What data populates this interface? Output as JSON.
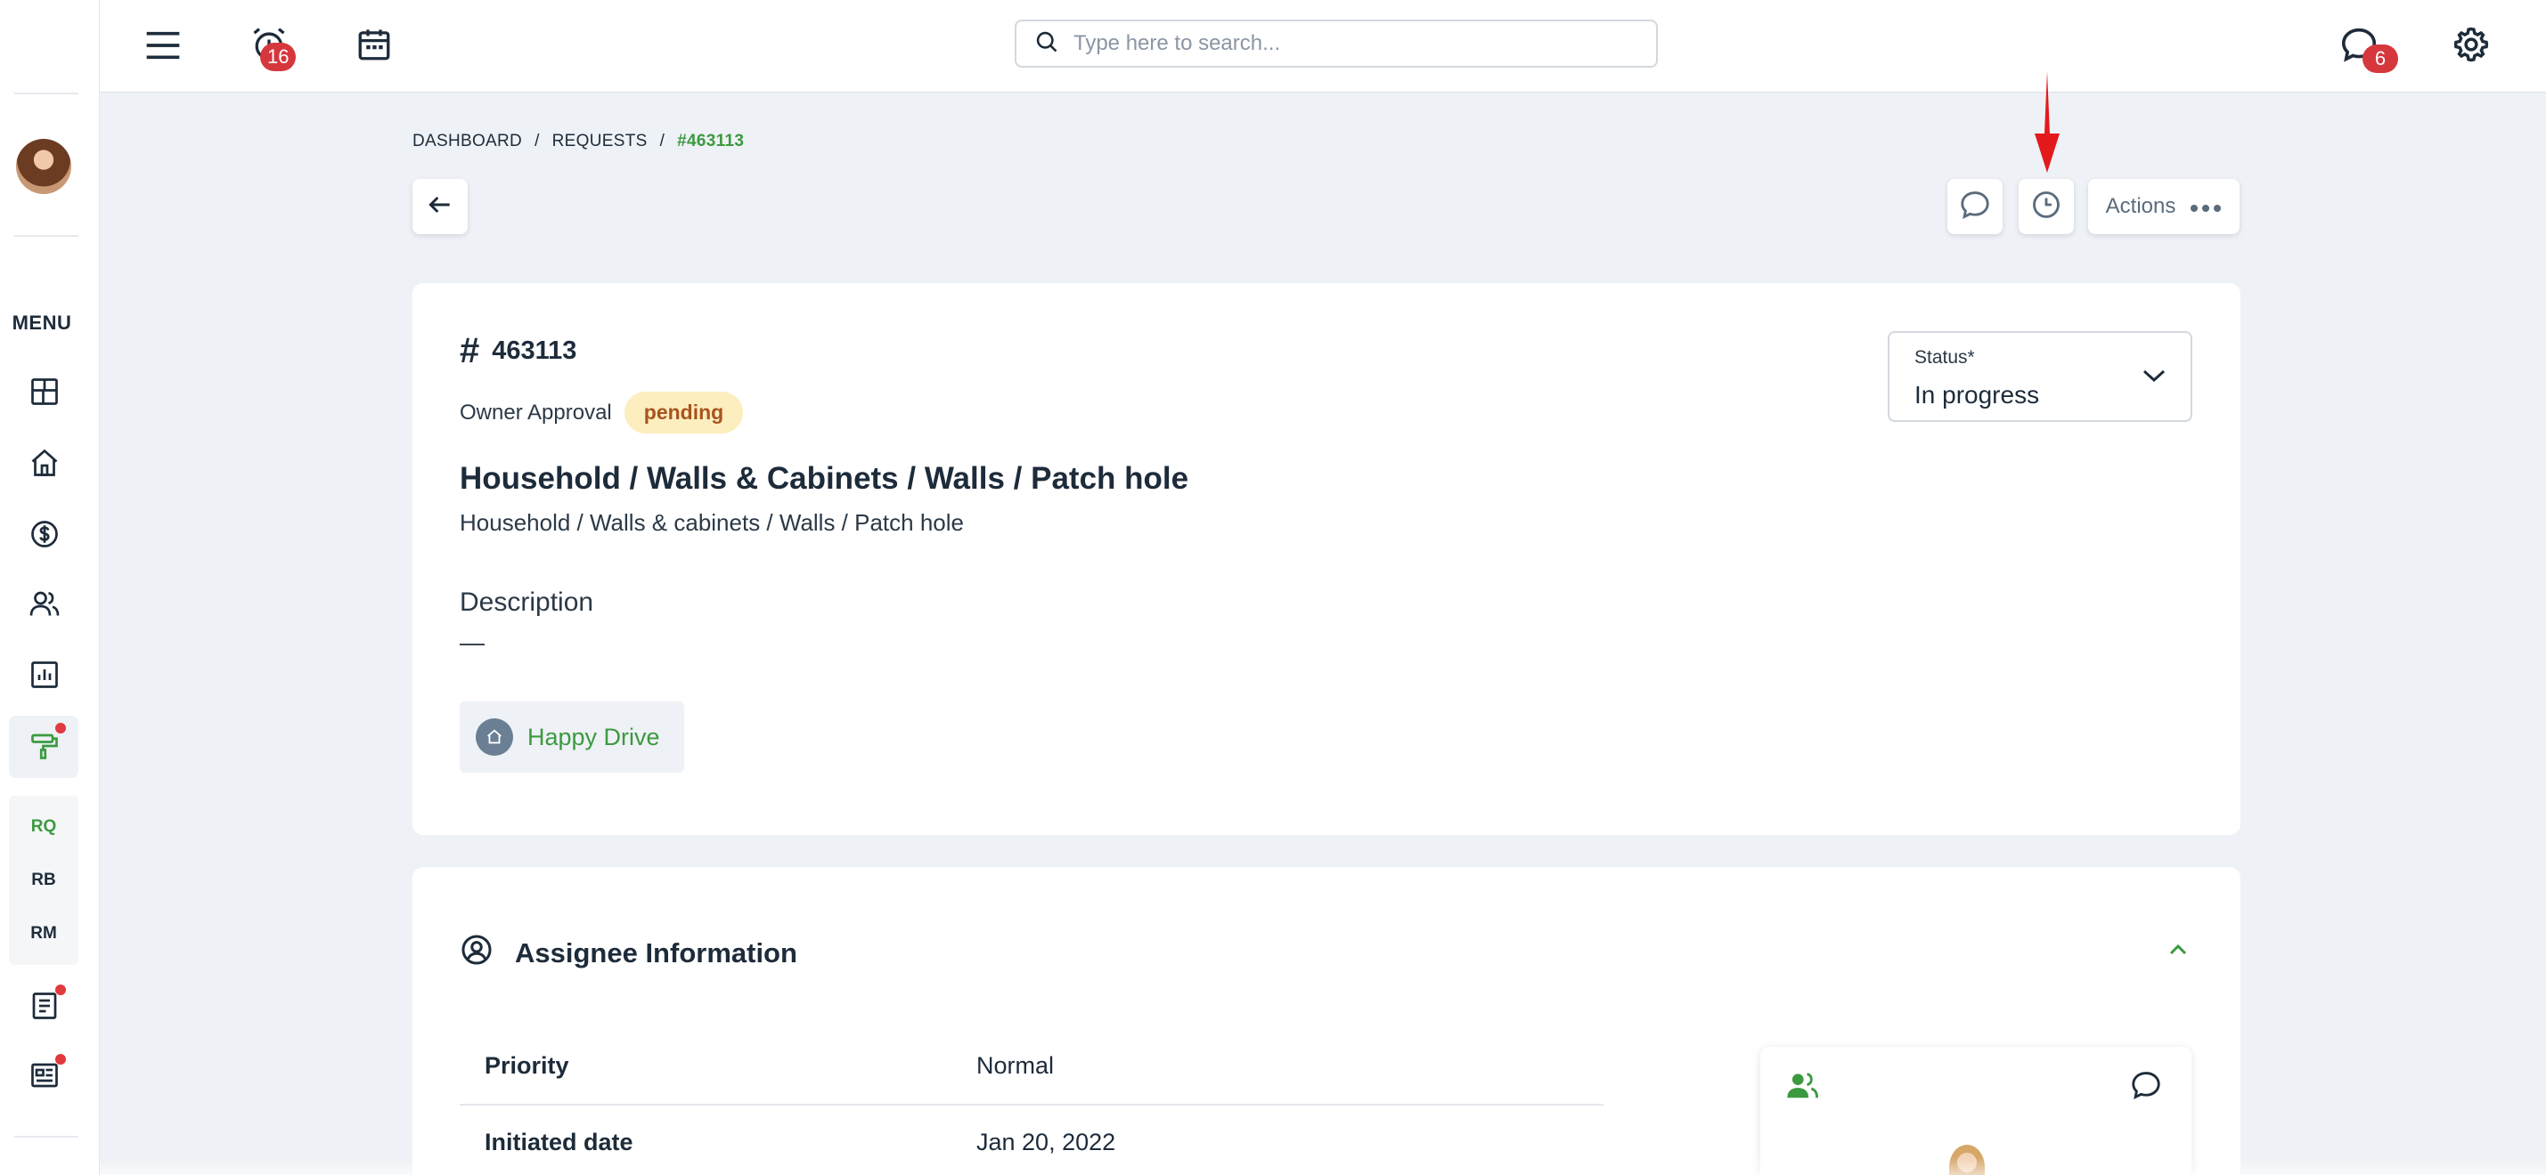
{
  "topbar": {
    "alarm_badge": "16",
    "search_placeholder": "Type here to search...",
    "chat_badge": "6"
  },
  "sidebar": {
    "menu_label": "MENU",
    "sub_items": [
      "RQ",
      "RB",
      "RM"
    ]
  },
  "breadcrumb": {
    "items": [
      "DASHBOARD",
      "REQUESTS"
    ],
    "separator": "/",
    "current": "#463113"
  },
  "toolbar": {
    "actions_label": "Actions"
  },
  "request": {
    "id": "463113",
    "approval_label": "Owner Approval",
    "approval_status": "pending",
    "title": "Household / Walls & Cabinets / Walls / Patch hole",
    "subtitle": "Household / Walls & cabinets / Walls / Patch hole",
    "description_label": "Description",
    "description_value": "—",
    "property_name": "Happy Drive",
    "status_label": "Status*",
    "status_value": "In progress"
  },
  "assignee": {
    "section_title": "Assignee Information",
    "rows": [
      {
        "key": "Priority",
        "value": "Normal"
      },
      {
        "key": "Initiated date",
        "value": "Jan 20, 2022"
      }
    ]
  },
  "colors": {
    "accent_green": "#3b9a3f",
    "badge_red": "#d6373d",
    "pending_bg": "#fdeebf",
    "pending_text": "#a8541e"
  }
}
